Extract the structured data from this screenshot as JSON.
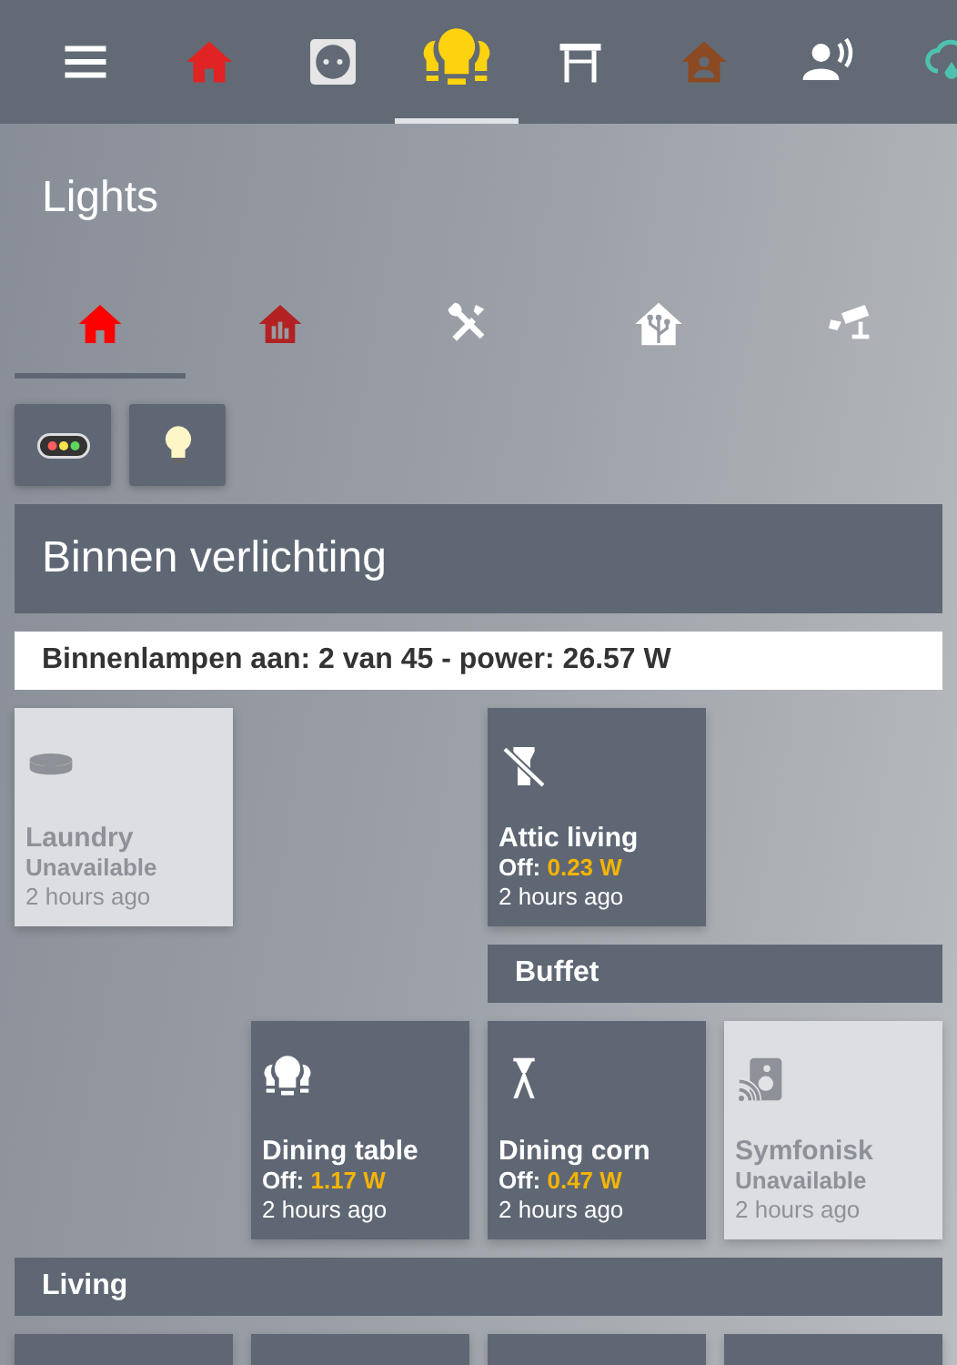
{
  "top_tabs": [
    {
      "kind": "menu",
      "color": "#ffffff"
    },
    {
      "kind": "home",
      "selected": false,
      "color": "#e02424"
    },
    {
      "kind": "outlet",
      "selected": false,
      "color": "#e6e6e6"
    },
    {
      "kind": "bulbs",
      "selected": true,
      "color": "#fdd20e"
    },
    {
      "kind": "table",
      "selected": false,
      "color": "#ffffff"
    },
    {
      "kind": "house-person",
      "selected": false,
      "color": "#8b4a22"
    },
    {
      "kind": "person-voice",
      "selected": false,
      "color": "#ffffff"
    },
    {
      "kind": "cloud-rain",
      "selected": false,
      "color": "#4fc1b0"
    }
  ],
  "title": "Lights",
  "view_tabs": [
    {
      "kind": "home",
      "selected": true,
      "color": "#ff0000"
    },
    {
      "kind": "house-chart",
      "selected": false,
      "color": "#b22222"
    },
    {
      "kind": "tools",
      "selected": false,
      "color": "#ffffff"
    },
    {
      "kind": "house-circuit",
      "selected": false,
      "color": "#ffffff"
    },
    {
      "kind": "camera",
      "selected": false,
      "color": "#ffffff"
    }
  ],
  "quick_buttons": [
    {
      "kind": "traffic-light"
    },
    {
      "kind": "bulb"
    }
  ],
  "section": {
    "title": "Binnen verlichting"
  },
  "summary": "Binnenlampen aan: 2 van 45 - power: 26.57 W",
  "groups": [
    {
      "tiles": [
        {
          "kind": "ceiling",
          "name": "Laundry",
          "available": false,
          "state": "Unavailable",
          "time": "2 hours ago"
        },
        {
          "kind": "flashlight-off",
          "name": "Attic living",
          "available": true,
          "state": "Off:",
          "power": "0.23 W",
          "time": "2 hours ago"
        }
      ]
    },
    {
      "title": "Buffet",
      "tiles": [
        {
          "kind": "bulbs",
          "name": "Dining table",
          "available": true,
          "state": "Off:",
          "power": "1.17 W",
          "time": "2 hours ago"
        },
        {
          "kind": "floor-lamp",
          "name": "Dining corn",
          "available": true,
          "state": "Off:",
          "power": "0.47 W",
          "time": "2 hours ago"
        },
        {
          "kind": "speaker",
          "name": "Symfonisk",
          "available": false,
          "state": "Unavailable",
          "time": "2 hours ago"
        }
      ]
    },
    {
      "title": "Living",
      "tiles": [
        {
          "kind": "blank"
        },
        {
          "kind": "blank"
        },
        {
          "kind": "blank"
        },
        {
          "kind": "blank"
        }
      ]
    }
  ]
}
